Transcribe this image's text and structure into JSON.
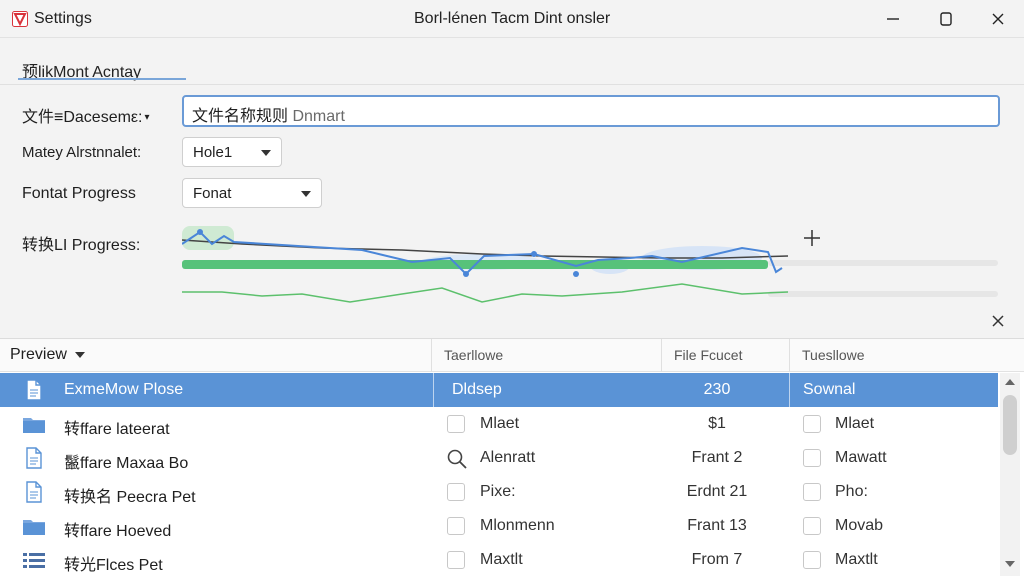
{
  "window": {
    "app_title": "Settings",
    "center_title": "Borl-lénen Tacm Dint onsler"
  },
  "section": {
    "tab_label": "预likMont Acntay"
  },
  "form": {
    "name_label": "文件≡Dacesemε:",
    "name_value_main": "文件名称规则",
    "name_value_secondary": "Dnmart",
    "naming_label": "Matey Alrstnnalet:",
    "naming_value": "Hole1",
    "fontat_label": "Fontat Progress",
    "fontat_value": "Fonat",
    "progress_label": "转换LI Progress:",
    "progress_bar_level": 0.72
  },
  "table": {
    "headers": {
      "preview": "Preview",
      "col2": "Taerllowe",
      "col3": "File Fcucet",
      "col4": "Tuesllowe"
    },
    "rows": [
      {
        "icon": "document-icon",
        "name": "ExmeMow Plose",
        "c2": "Dldsep",
        "c3": "230",
        "c4": "Sownal",
        "selected": true
      },
      {
        "icon": "folder-icon",
        "name": "转ffare lateerat",
        "c2": "Mlaet",
        "c3": "$1",
        "c4": "Mlaet"
      },
      {
        "icon": "document-icon",
        "name": "鬣ffare Maxaa Bo",
        "c2": "Alenratt",
        "c3": "Frant 2",
        "c4": "Mawatt",
        "search": true
      },
      {
        "icon": "document-icon",
        "name": "转换名 Peecra Pet",
        "c2": "Pixe:",
        "c3": "Erdnt 21",
        "c4": "Pho:"
      },
      {
        "icon": "folder-icon",
        "name": "转ffare Hoeved",
        "c2": "Mlonmenn",
        "c3": "Frant 13",
        "c4": "Movab"
      },
      {
        "icon": "list-icon",
        "name": "转光Flces Pet",
        "c2": "Maxtlt",
        "c3": "From 7",
        "c4": "Maxtlt"
      }
    ]
  },
  "colors": {
    "accent": "#5a93d6",
    "progress_green": "#57c27a",
    "line_blue": "#4a86d8",
    "line_dark": "#444444",
    "line_green": "#5cc06c"
  }
}
